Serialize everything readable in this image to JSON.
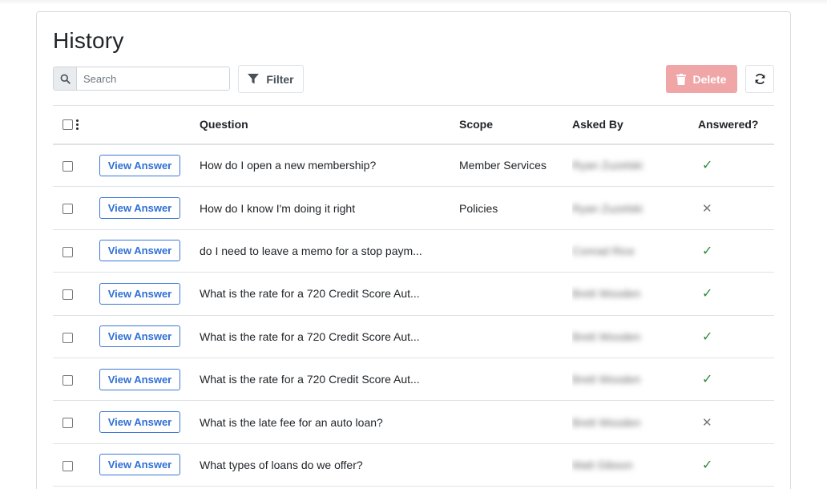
{
  "page": {
    "title": "History"
  },
  "toolbar": {
    "search_placeholder": "Search",
    "filter_label": "Filter",
    "delete_label": "Delete"
  },
  "table": {
    "columns": [
      "",
      "",
      "Question",
      "Scope",
      "Asked By",
      "Answered?"
    ],
    "view_label": "View Answer",
    "rows": [
      {
        "question": "How do I open a new membership?",
        "scope": "Member Services",
        "asked_by": "Ryan Zuzelski",
        "answered": true
      },
      {
        "question": "How do I know I'm doing it right",
        "scope": "Policies",
        "asked_by": "Ryan Zuzelski",
        "answered": false
      },
      {
        "question": "do I need to leave a memo for a stop paym...",
        "scope": "",
        "asked_by": "Conrad Rice",
        "answered": true
      },
      {
        "question": "What is the rate for a 720 Credit Score Aut...",
        "scope": "",
        "asked_by": "Brett Wooden",
        "answered": true
      },
      {
        "question": "What is the rate for a 720 Credit Score Aut...",
        "scope": "",
        "asked_by": "Brett Wooden",
        "answered": true
      },
      {
        "question": "What is the rate for a 720 Credit Score Aut...",
        "scope": "",
        "asked_by": "Brett Wooden",
        "answered": true
      },
      {
        "question": "What is the late fee for an auto loan?",
        "scope": "",
        "asked_by": "Brett Wooden",
        "answered": false
      },
      {
        "question": "What types of loans do we offer?",
        "scope": "",
        "asked_by": "Matt Gibson",
        "answered": true
      }
    ]
  },
  "marks": {
    "yes": "✓",
    "no": "✕"
  },
  "colors": {
    "delete_bg": "#f0a6a6",
    "link_blue": "#2f6fd6",
    "check_green": "#2e8b3a"
  }
}
